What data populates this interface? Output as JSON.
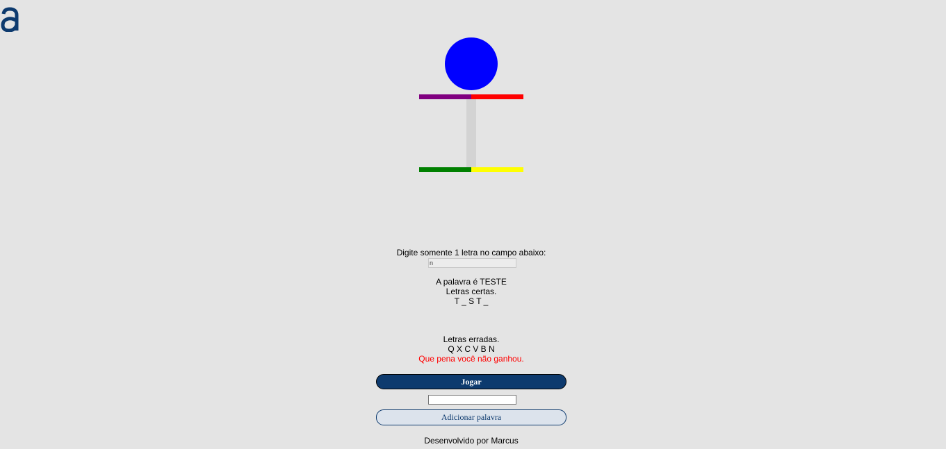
{
  "logo": {
    "icon": "brand-a-logo-icon",
    "color": "#0d3a6e"
  },
  "hangman": {
    "head_color": "#0000ff",
    "left_arm_color": "#800080",
    "right_arm_color": "#ff0000",
    "body_color": "#d3d3d3",
    "left_leg_color": "#008000",
    "right_leg_color": "#ffff00"
  },
  "instruction": "Digite somente 1 letra no campo abaixo:",
  "letter_input": {
    "value": "n"
  },
  "word_reveal": "A palavra é TESTE",
  "correct_letters_label": "Letras certas.",
  "correct_letters": "T _ S T _",
  "wrong_letters_label": "Letras erradas.",
  "wrong_letters": "Q X C V B N",
  "lose_message": "Que pena você não ganhou.",
  "play_button": "Jogar",
  "new_word_input": {
    "value": ""
  },
  "add_word_button": "Adicionar palavra",
  "footer": "Desenvolvido por Marcus",
  "colors": {
    "accent": "#0d3a6e",
    "lose": "#ff0000",
    "background": "#e4e4e4"
  }
}
